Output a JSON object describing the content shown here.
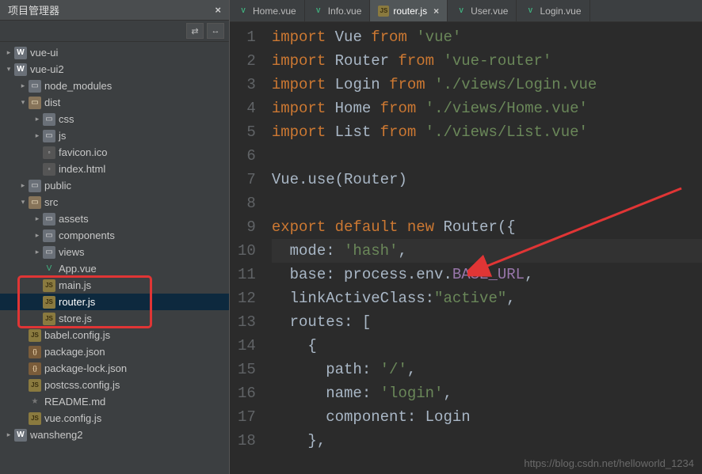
{
  "sidebar": {
    "title": "项目管理器",
    "toolbar": {
      "btn1": "⇄",
      "btn2": "↔"
    },
    "tree": [
      {
        "depth": 0,
        "arrow": "▸",
        "icon": "w",
        "iconText": "W",
        "label": "vue-ui"
      },
      {
        "depth": 0,
        "arrow": "▾",
        "icon": "w",
        "iconText": "W",
        "label": "vue-ui2"
      },
      {
        "depth": 1,
        "arrow": "▸",
        "icon": "folder",
        "iconText": "▭",
        "label": "node_modules"
      },
      {
        "depth": 1,
        "arrow": "▾",
        "icon": "folder-open",
        "iconText": "▭",
        "label": "dist"
      },
      {
        "depth": 2,
        "arrow": "▸",
        "icon": "folder",
        "iconText": "▭",
        "label": "css"
      },
      {
        "depth": 2,
        "arrow": "▸",
        "icon": "folder",
        "iconText": "▭",
        "label": "js"
      },
      {
        "depth": 2,
        "arrow": "",
        "icon": "file",
        "iconText": "▫",
        "label": "favicon.ico"
      },
      {
        "depth": 2,
        "arrow": "",
        "icon": "html",
        "iconText": "▫",
        "label": "index.html"
      },
      {
        "depth": 1,
        "arrow": "▸",
        "icon": "folder",
        "iconText": "▭",
        "label": "public"
      },
      {
        "depth": 1,
        "arrow": "▾",
        "icon": "folder-open",
        "iconText": "▭",
        "label": "src"
      },
      {
        "depth": 2,
        "arrow": "▸",
        "icon": "folder",
        "iconText": "▭",
        "label": "assets"
      },
      {
        "depth": 2,
        "arrow": "▸",
        "icon": "folder",
        "iconText": "▭",
        "label": "components"
      },
      {
        "depth": 2,
        "arrow": "▸",
        "icon": "folder",
        "iconText": "▭",
        "label": "views"
      },
      {
        "depth": 2,
        "arrow": "",
        "icon": "vue",
        "iconText": "V",
        "label": "App.vue"
      },
      {
        "depth": 2,
        "arrow": "",
        "icon": "js",
        "iconText": "JS",
        "label": "main.js"
      },
      {
        "depth": 2,
        "arrow": "",
        "icon": "js",
        "iconText": "JS",
        "label": "router.js",
        "selected": true
      },
      {
        "depth": 2,
        "arrow": "",
        "icon": "js",
        "iconText": "JS",
        "label": "store.js"
      },
      {
        "depth": 1,
        "arrow": "",
        "icon": "js",
        "iconText": "JS",
        "label": "babel.config.js"
      },
      {
        "depth": 1,
        "arrow": "",
        "icon": "json",
        "iconText": "{}",
        "label": "package.json"
      },
      {
        "depth": 1,
        "arrow": "",
        "icon": "json",
        "iconText": "{}",
        "label": "package-lock.json"
      },
      {
        "depth": 1,
        "arrow": "",
        "icon": "js",
        "iconText": "JS",
        "label": "postcss.config.js"
      },
      {
        "depth": 1,
        "arrow": "",
        "icon": "star",
        "iconText": "★",
        "label": "README.md"
      },
      {
        "depth": 1,
        "arrow": "",
        "icon": "js",
        "iconText": "JS",
        "label": "vue.config.js"
      },
      {
        "depth": 0,
        "arrow": "▸",
        "icon": "w",
        "iconText": "W",
        "label": "wansheng2"
      }
    ]
  },
  "tabs": [
    {
      "icon": "vue",
      "iconText": "V",
      "label": "Home.vue"
    },
    {
      "icon": "vue",
      "iconText": "V",
      "label": "Info.vue"
    },
    {
      "icon": "js",
      "iconText": "JS",
      "label": "router.js",
      "active": true,
      "modified": true
    },
    {
      "icon": "vue",
      "iconText": "V",
      "label": "User.vue"
    },
    {
      "icon": "vue",
      "iconText": "V",
      "label": "Login.vue"
    }
  ],
  "code": {
    "lines": [
      {
        "n": 1,
        "tokens": [
          [
            "kw",
            "import"
          ],
          [
            "id",
            " Vue "
          ],
          [
            "kw",
            "from"
          ],
          [
            "id",
            " "
          ],
          [
            "str",
            "'vue'"
          ]
        ]
      },
      {
        "n": 2,
        "tokens": [
          [
            "kw",
            "import"
          ],
          [
            "id",
            " Router "
          ],
          [
            "kw",
            "from"
          ],
          [
            "id",
            " "
          ],
          [
            "str",
            "'vue-router'"
          ]
        ]
      },
      {
        "n": 3,
        "tokens": [
          [
            "kw",
            "import"
          ],
          [
            "id",
            " Login "
          ],
          [
            "kw",
            "from"
          ],
          [
            "id",
            " "
          ],
          [
            "str",
            "'./views/Login.vue"
          ]
        ]
      },
      {
        "n": 4,
        "tokens": [
          [
            "kw",
            "import"
          ],
          [
            "id",
            " Home "
          ],
          [
            "kw",
            "from"
          ],
          [
            "id",
            " "
          ],
          [
            "str",
            "'./views/Home.vue'"
          ]
        ]
      },
      {
        "n": 5,
        "tokens": [
          [
            "kw",
            "import"
          ],
          [
            "id",
            " List "
          ],
          [
            "kw",
            "from"
          ],
          [
            "id",
            " "
          ],
          [
            "str",
            "'./views/List.vue'"
          ]
        ]
      },
      {
        "n": 6,
        "tokens": []
      },
      {
        "n": 7,
        "tokens": [
          [
            "id",
            "Vue.use(Router)"
          ]
        ]
      },
      {
        "n": 8,
        "tokens": []
      },
      {
        "n": 9,
        "tokens": [
          [
            "kw",
            "export default new"
          ],
          [
            "id",
            " Router({"
          ]
        ]
      },
      {
        "n": 10,
        "hl": true,
        "tokens": [
          [
            "id",
            "  mode: "
          ],
          [
            "str",
            "'hash'"
          ],
          [
            "id",
            ","
          ]
        ]
      },
      {
        "n": 11,
        "tokens": [
          [
            "id",
            "  base: process.env."
          ],
          [
            "const",
            "BASE_URL"
          ],
          [
            "id",
            ","
          ]
        ]
      },
      {
        "n": 12,
        "tokens": [
          [
            "id",
            "  linkActiveClass:"
          ],
          [
            "str",
            "\"active\""
          ],
          [
            "id",
            ","
          ]
        ]
      },
      {
        "n": 13,
        "tokens": [
          [
            "id",
            "  routes: ["
          ]
        ]
      },
      {
        "n": 14,
        "tokens": [
          [
            "id",
            "    {"
          ]
        ]
      },
      {
        "n": 15,
        "tokens": [
          [
            "id",
            "      path: "
          ],
          [
            "str",
            "'/'"
          ],
          [
            "id",
            ","
          ]
        ]
      },
      {
        "n": 16,
        "tokens": [
          [
            "id",
            "      name: "
          ],
          [
            "str",
            "'login'"
          ],
          [
            "id",
            ","
          ]
        ]
      },
      {
        "n": 17,
        "tokens": [
          [
            "id",
            "      component: Login"
          ]
        ]
      },
      {
        "n": 18,
        "tokens": [
          [
            "id",
            "    },"
          ]
        ]
      }
    ]
  },
  "watermark": "https://blog.csdn.net/helloworld_1234"
}
